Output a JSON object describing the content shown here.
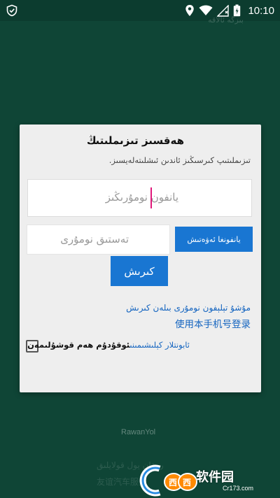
{
  "status_bar": {
    "time": "10:10",
    "icons": [
      "shield-icon",
      "location-icon",
      "wifi-icon",
      "signal-icon",
      "battery-icon"
    ]
  },
  "background": {
    "faint_top_text": "بىزگە ئالاقە",
    "brand_name": "RawanYol",
    "faint_bottom_ug": "رەۋان يول قولايلىق",
    "faint_bottom_cn": "友谊汽车服务"
  },
  "login_dialog": {
    "title": "ھەقسىز تىزىملىتىڭ",
    "subtitle": "تىزىملىتىپ كىرسىڭىز ئاندىن ئىشلىتەلەيسىز.",
    "username_placeholder": "يانفون نومۇرىڭىز",
    "code_placeholder": "تەستىق نومۇرى",
    "get_code_label": "يانفونغا ئەۋەتىش",
    "login_label": "كىرىش",
    "phone_login_link": "مۇشۇ تېلېفون نومۇرى بىلەن كىرىش",
    "phone_login_link_cn": "使用本手机号登录",
    "agreement": {
      "link_text": "ئابونتلار كېلىشىمىنى",
      "plain_text": "ئوقۇدۇم ھەم قوشۇلىمەن",
      "checked": false
    }
  },
  "watermark": {
    "site_name": "软件园",
    "url": "Cr173.com"
  },
  "colors": {
    "background": "#0f4536",
    "accent": "#1976d2",
    "link": "#1565c0",
    "cursor": "#e0187a"
  }
}
